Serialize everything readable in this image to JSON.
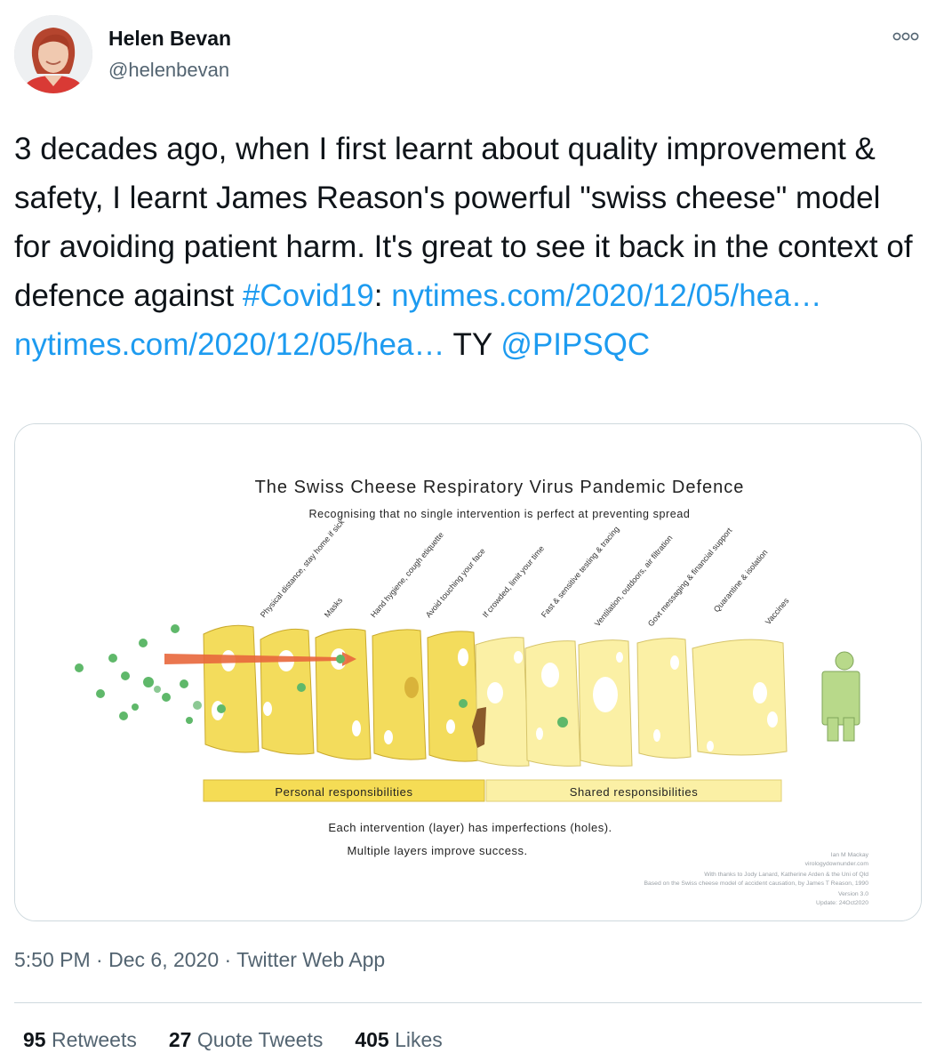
{
  "author": {
    "name": "Helen Bevan",
    "handle": "@helenbevan"
  },
  "tweet": {
    "text_1": "3 decades ago, when I first learnt about quality improvement & safety, I learnt James Reason's powerful \"swiss cheese\" model for avoiding patient harm. It's great to see it back in the context of defence against ",
    "hashtag": "#Covid19",
    "colon": ": ",
    "link_1": "nytimes.com/2020/12/05/hea…",
    "link_2": "nytimes.com/2020/12/05/hea…",
    "ty": " TY ",
    "mention": "@PIPSQC"
  },
  "image": {
    "title": "The Swiss Cheese Respiratory Virus Pandemic Defence",
    "subtitle": "Recognising that no single intervention is perfect at preventing spread",
    "layers": [
      "Physical distance, stay home if sick",
      "Masks",
      "Hand hygiene, cough etiquette",
      "Avoid touching your face",
      "If crowded, limit your time",
      "Fast & sensitive testing & tracing",
      "Ventilation, outdoors, air filtration",
      "Govt messaging & financial support",
      "Quarantine & isolation",
      "Vaccines"
    ],
    "personal_label": "Personal responsibilities",
    "shared_label": "Shared responsibilities",
    "caption_1": "Each intervention (layer) has imperfections (holes).",
    "caption_2": "Multiple layers improve success.",
    "credit_1": "Ian M Mackay",
    "credit_2": "virologydownunder.com",
    "credit_3": "With thanks to Jody Lanard, Katherine Arden & the Uni of Qld",
    "credit_4": "Based on the Swiss cheese model of accident causation, by James T Reason, 1990",
    "credit_5": "Version 3.0",
    "credit_6": "Update: 24Oct2020"
  },
  "meta": {
    "time": "5:50 PM",
    "sep_1": " · ",
    "date": "Dec 6, 2020",
    "sep_2": " · ",
    "source": "Twitter Web App"
  },
  "stats": {
    "retweets_count": "95",
    "retweets_label": "Retweets",
    "quotes_count": "27",
    "quotes_label": "Quote Tweets",
    "likes_count": "405",
    "likes_label": "Likes"
  },
  "colors": {
    "link": "#1d9bf0",
    "secondary_text": "#536471",
    "cheese_dark": "#f3dc5c",
    "cheese_light": "#fbf0a5",
    "virus": "#5fb86a",
    "arrow": "#e8673c",
    "person": "#b8d98a"
  },
  "icons": {
    "more": "more-horizontal-icon"
  }
}
